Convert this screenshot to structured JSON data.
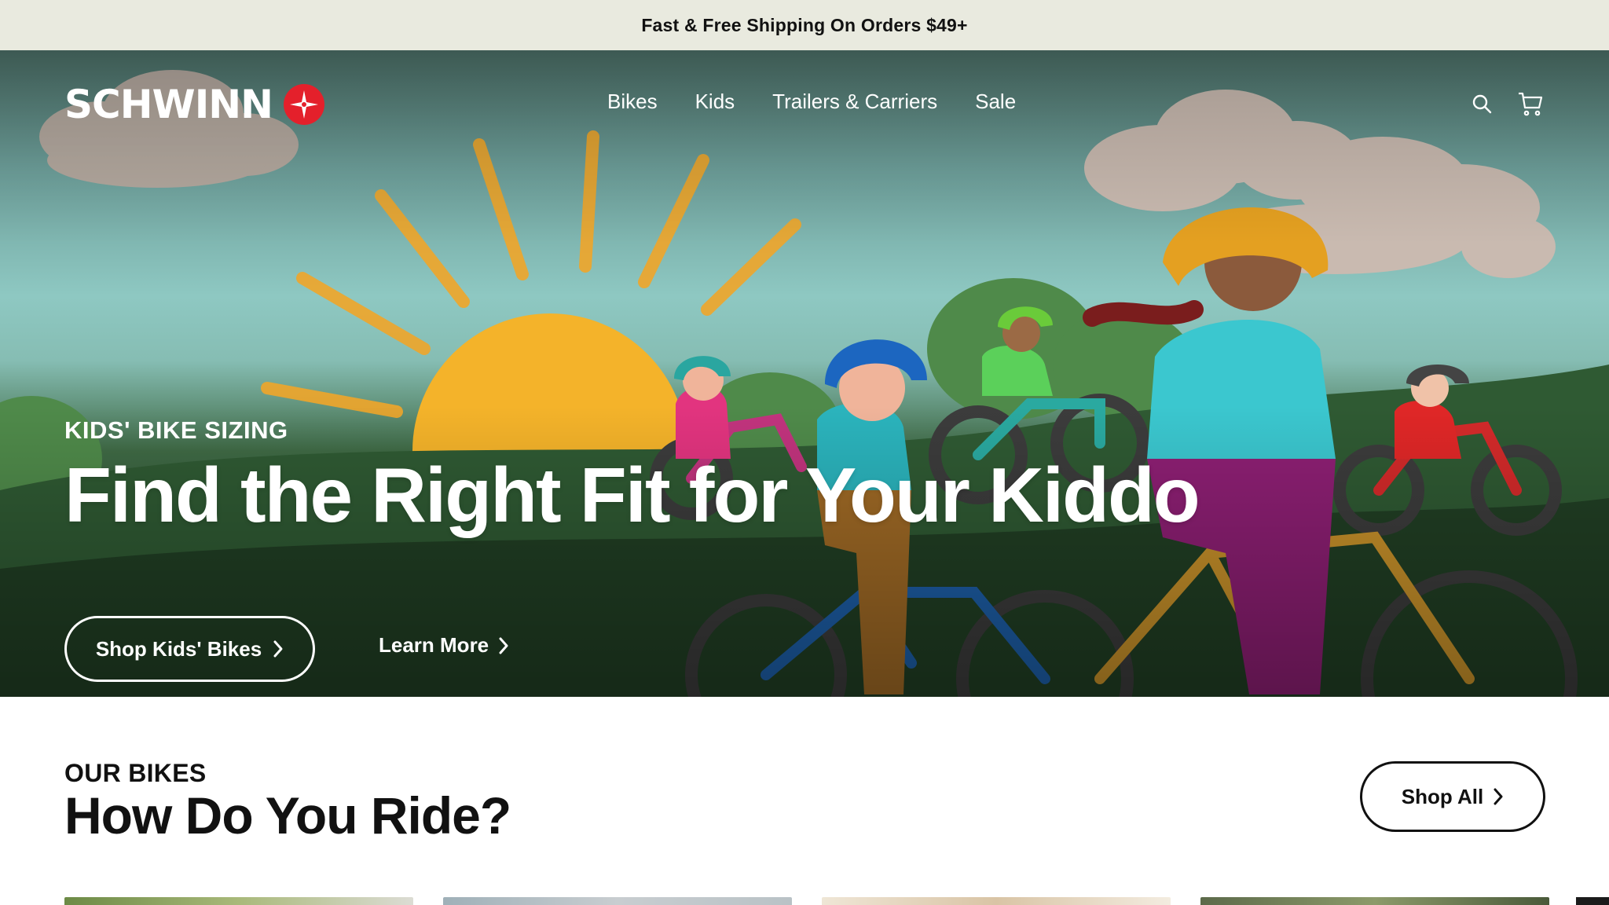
{
  "announcement": {
    "text": "Fast & Free Shipping On Orders $49+"
  },
  "header": {
    "logo_text": "SCHWINN",
    "nav": [
      {
        "label": "Bikes"
      },
      {
        "label": "Kids"
      },
      {
        "label": "Trailers & Carriers"
      },
      {
        "label": "Sale"
      }
    ],
    "icons": [
      "search-icon",
      "cart-icon"
    ]
  },
  "hero": {
    "eyebrow": "KIDS' BIKE SIZING",
    "headline": "Find the Right Fit for Your Kiddo",
    "primary_cta": "Shop Kids' Bikes",
    "secondary_cta": "Learn More"
  },
  "section": {
    "eyebrow": "OUR BIKES",
    "title": "How Do You Ride?",
    "cta": "Shop All"
  },
  "colors": {
    "brand_red": "#e4202b",
    "announcement_bg": "#e9eadf",
    "text_dark": "#111111"
  }
}
